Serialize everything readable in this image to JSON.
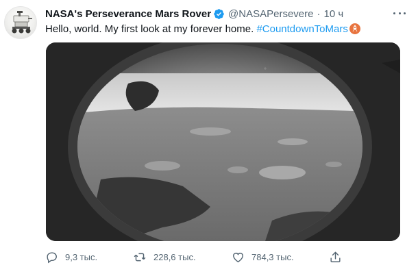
{
  "tweet": {
    "author": {
      "display_name": "NASA's Perseverance Mars Rover",
      "handle": "@NASAPersevere",
      "verified": true,
      "avatar_icon": "rover-avatar-icon"
    },
    "separator": "·",
    "time": "10 ч",
    "text": {
      "body": "Hello, world. My first look at my forever home. ",
      "hashtag": "#CountdownToMars",
      "emoji_icon": "rocket-emoji-icon"
    },
    "media": {
      "kind": "photo",
      "description_icon": "mars-surface-photo"
    },
    "actions": {
      "reply": {
        "icon": "reply-icon",
        "count": "9,3 тыс."
      },
      "retweet": {
        "icon": "retweet-icon",
        "count": "228,6 тыс."
      },
      "like": {
        "icon": "heart-icon",
        "count": "784,3 тыс."
      },
      "share": {
        "icon": "share-icon"
      }
    },
    "more_icon": "more-options-icon"
  },
  "colors": {
    "text": "#0f1419",
    "secondary": "#536471",
    "accent": "#1d9bf0",
    "verified": "#1d9bf0",
    "emoji": "#e0683c"
  }
}
